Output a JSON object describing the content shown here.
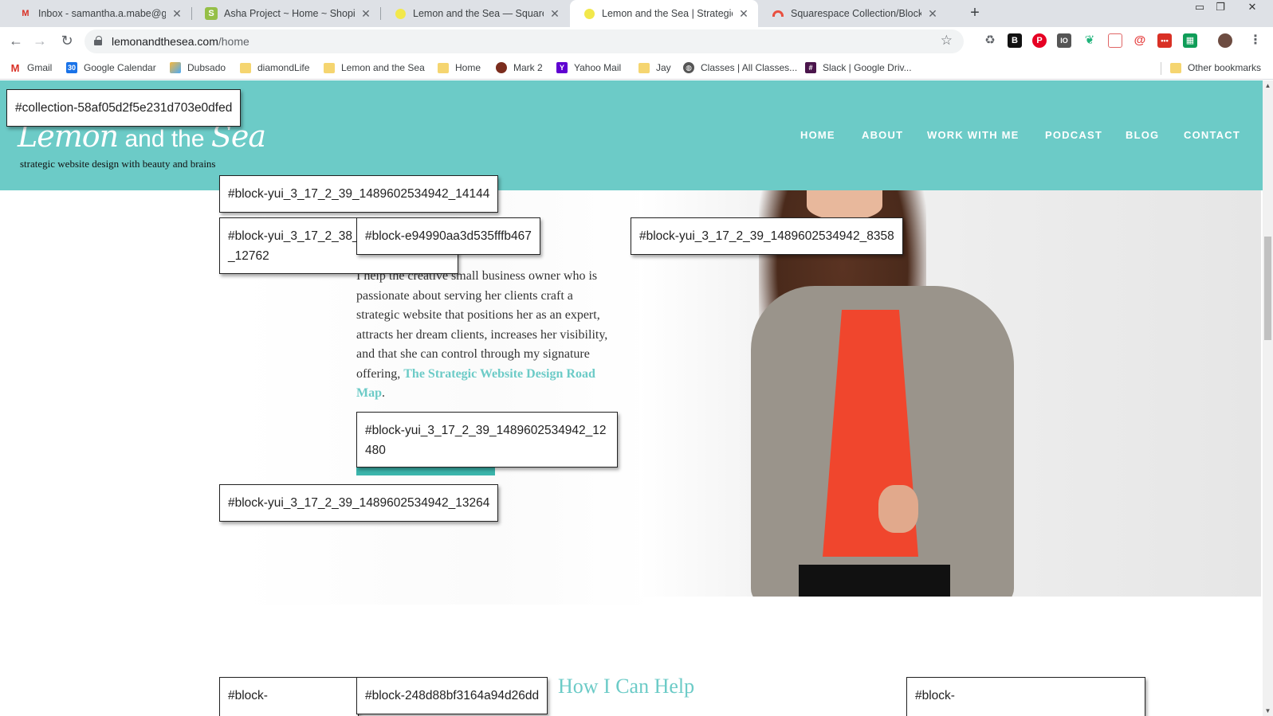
{
  "tabs": [
    {
      "title": "Inbox - samantha.a.mabe@gmail.com",
      "favicon": "gmail-icon",
      "active": false
    },
    {
      "title": "Asha Project ~ Home ~ Shopify",
      "favicon": "shopify-icon",
      "active": false
    },
    {
      "title": "Lemon and the Sea — Squarespace",
      "favicon": "lemon-icon",
      "active": false
    },
    {
      "title": "Lemon and the Sea | Strategic Website",
      "favicon": "lemon-icon",
      "active": true
    },
    {
      "title": "Squarespace Collection/Block Identifier",
      "favicon": "rainbow-icon",
      "active": false
    }
  ],
  "toolbar": {
    "url_host": "lemonandthesea.com",
    "url_path": "/home"
  },
  "bookmarks": [
    {
      "label": "Gmail",
      "icon": "gmail-icon"
    },
    {
      "label": "Google Calendar",
      "icon": "calendar-icon"
    },
    {
      "label": "Dubsado",
      "icon": "dubsado-icon"
    },
    {
      "label": "diamondLife",
      "icon": "folder-icon"
    },
    {
      "label": "Lemon and the Sea",
      "icon": "folder-icon"
    },
    {
      "label": "Home",
      "icon": "folder-icon"
    },
    {
      "label": "Mark 2",
      "icon": "mark-icon"
    },
    {
      "label": "Yahoo Mail",
      "icon": "yahoo-icon"
    },
    {
      "label": "Jay",
      "icon": "folder-icon"
    },
    {
      "label": "Classes | All Classes...",
      "icon": "globe-icon"
    },
    {
      "label": "Slack | Google Driv...",
      "icon": "slack-icon"
    }
  ],
  "other_bookmarks": "Other bookmarks",
  "site": {
    "logo_script": "Lemon",
    "logo_plain": " and the ",
    "logo_script2": "Sea",
    "tagline": "strategic website design with beauty and brains",
    "nav": [
      "HOME",
      "ABOUT",
      "WORK WITH ME",
      "PODCAST",
      "BLOG",
      "CONTACT"
    ],
    "intro_text": "I help the creative small business owner who is passionate about serving her clients craft a strategic website that positions her as an expert, attracts her dream clients, increases her visibility, and that she can control through my signature offering, ",
    "intro_link": "The Strategic Website Design Road Map",
    "intro_end": ".",
    "help_heading": "How I Can Help"
  },
  "blocks": [
    "#collection-58af05d2f5e231d703e0dfed",
    "#block-yui_3_17_2_39_1489602534942_14144",
    "#block-yui_3_17_2_38_1489602534942_12762",
    "#block-e94990aa3d535fffb467",
    "#block-yui_3_17_2_39_1489602534942_8358",
    "#block-yui_3_17_2_39_1489602534942_12480",
    "#block-yui_3_17_2_39_1489602534942_13264",
    "#block-",
    "#block-248d88bf3164a94d26dd",
    "#block-"
  ],
  "colors": {
    "brand_teal": "#6ccbc7",
    "accent": "#3bb5ac"
  }
}
